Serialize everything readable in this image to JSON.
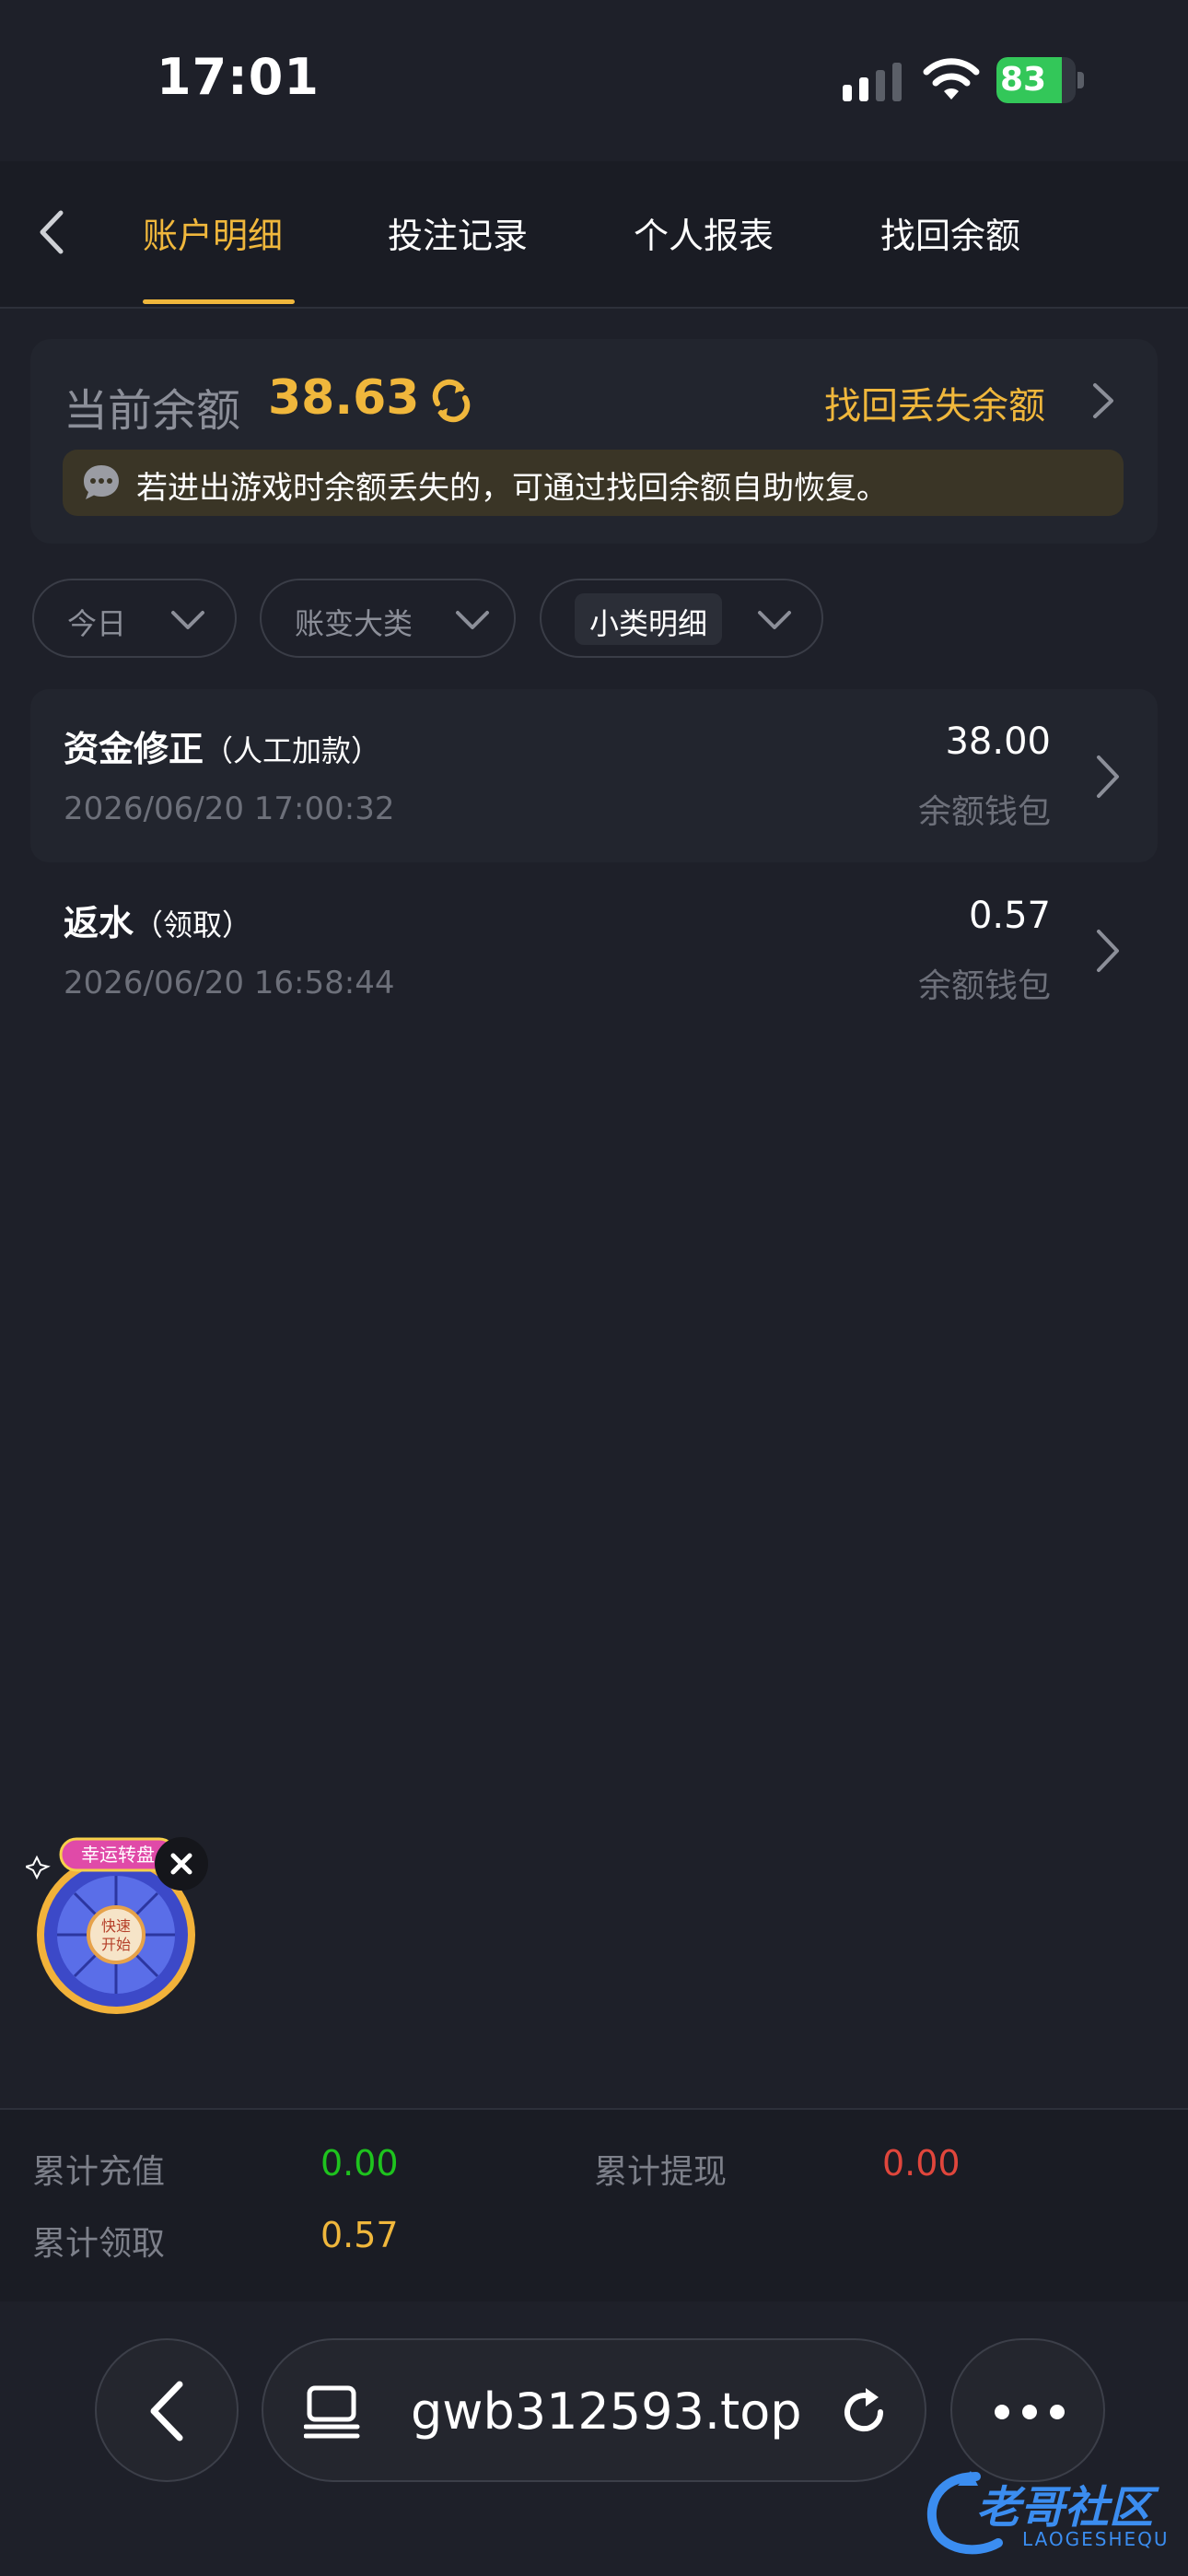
{
  "status_bar": {
    "time": "17:01",
    "battery_level": "83",
    "battery_fraction": 0.83,
    "charging": true
  },
  "tabs": {
    "items": [
      {
        "label": "账户明细",
        "active": true
      },
      {
        "label": "投注记录",
        "active": false
      },
      {
        "label": "个人报表",
        "active": false
      },
      {
        "label": "找回余额",
        "active": false
      }
    ],
    "accent_color": "#f0b73c"
  },
  "balance": {
    "label": "当前余额",
    "value": "38.63",
    "recover_link": "找回丢失余额",
    "notice": "若进出游戏时余额丢失的，可通过找回余额自助恢复。"
  },
  "filters": [
    {
      "label": "今日"
    },
    {
      "label": "账变大类"
    },
    {
      "label": "小类明细"
    }
  ],
  "transactions": [
    {
      "title": "资金修正",
      "subtitle": "（人工加款）",
      "datetime": "2026/06/20 17:00:32",
      "amount": "38.00",
      "wallet": "余额钱包"
    },
    {
      "title": "返水",
      "subtitle": "（领取）",
      "datetime": "2026/06/20 16:58:44",
      "amount": "0.57",
      "wallet": "余额钱包"
    }
  ],
  "widget": {
    "banner": "幸运转盘",
    "center_text": "快速开始"
  },
  "summary": {
    "recharge_label": "累计充值",
    "recharge_value": "0.00",
    "withdraw_label": "累计提现",
    "withdraw_value": "0.00",
    "claimed_label": "累计领取",
    "claimed_value": "0.57",
    "colors": {
      "recharge": "#1ec31e",
      "withdraw": "#e0463c",
      "claimed": "#f0b73c"
    }
  },
  "browser": {
    "url": "gwb312593.top"
  },
  "watermark": {
    "text": "老哥社区",
    "sub": "LAOGESHEQU"
  }
}
